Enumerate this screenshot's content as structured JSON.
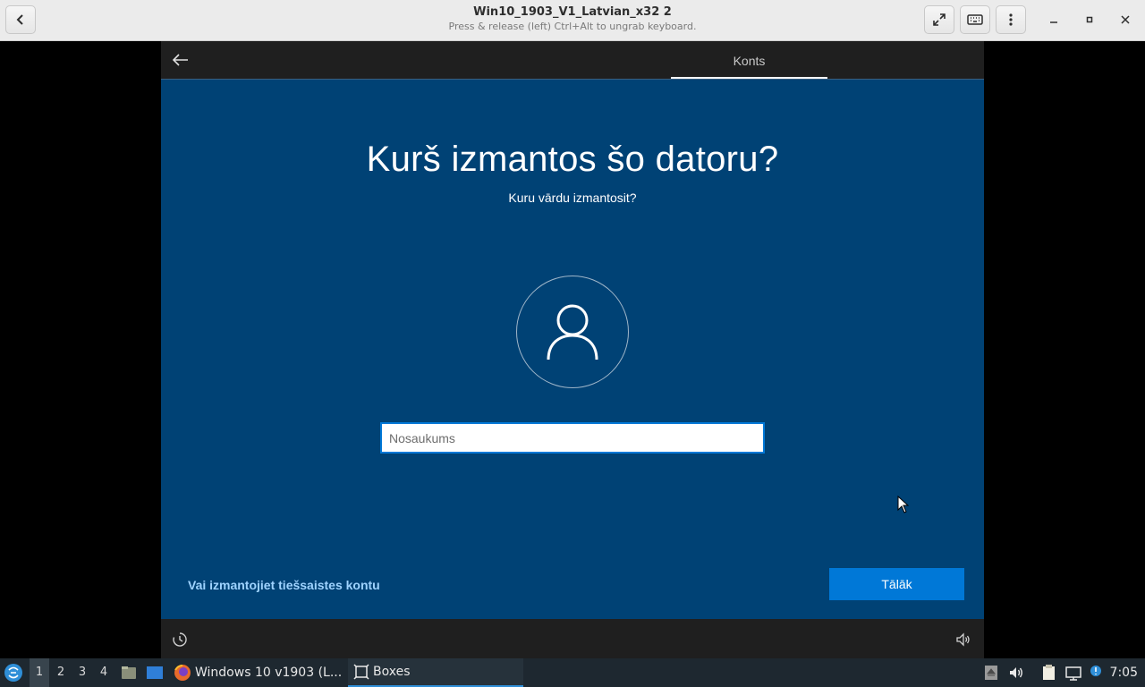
{
  "header": {
    "title": "Win10_1903_V1_Latvian_x32 2",
    "subtitle": "Press & release (left) Ctrl+Alt to ungrab keyboard."
  },
  "vm": {
    "tab_label": "Konts",
    "heading": "Kurš izmantos šo datoru?",
    "subheading": "Kuru vārdu izmantosit?",
    "name_placeholder": "Nosaukums",
    "name_value": "",
    "online_link": "Vai izmantojiet tiešsaistes kontu",
    "next_button": "Tālāk",
    "accent": "#0078d7",
    "background": "#004275"
  },
  "taskbar": {
    "workspaces": [
      "1",
      "2",
      "3",
      "4"
    ],
    "active_workspace": "1",
    "tasks": [
      {
        "label": "Windows 10 v1903 (L...",
        "icon": "firefox-icon"
      },
      {
        "label": "Boxes",
        "icon": "boxes-icon"
      }
    ],
    "clock": "7:05"
  }
}
